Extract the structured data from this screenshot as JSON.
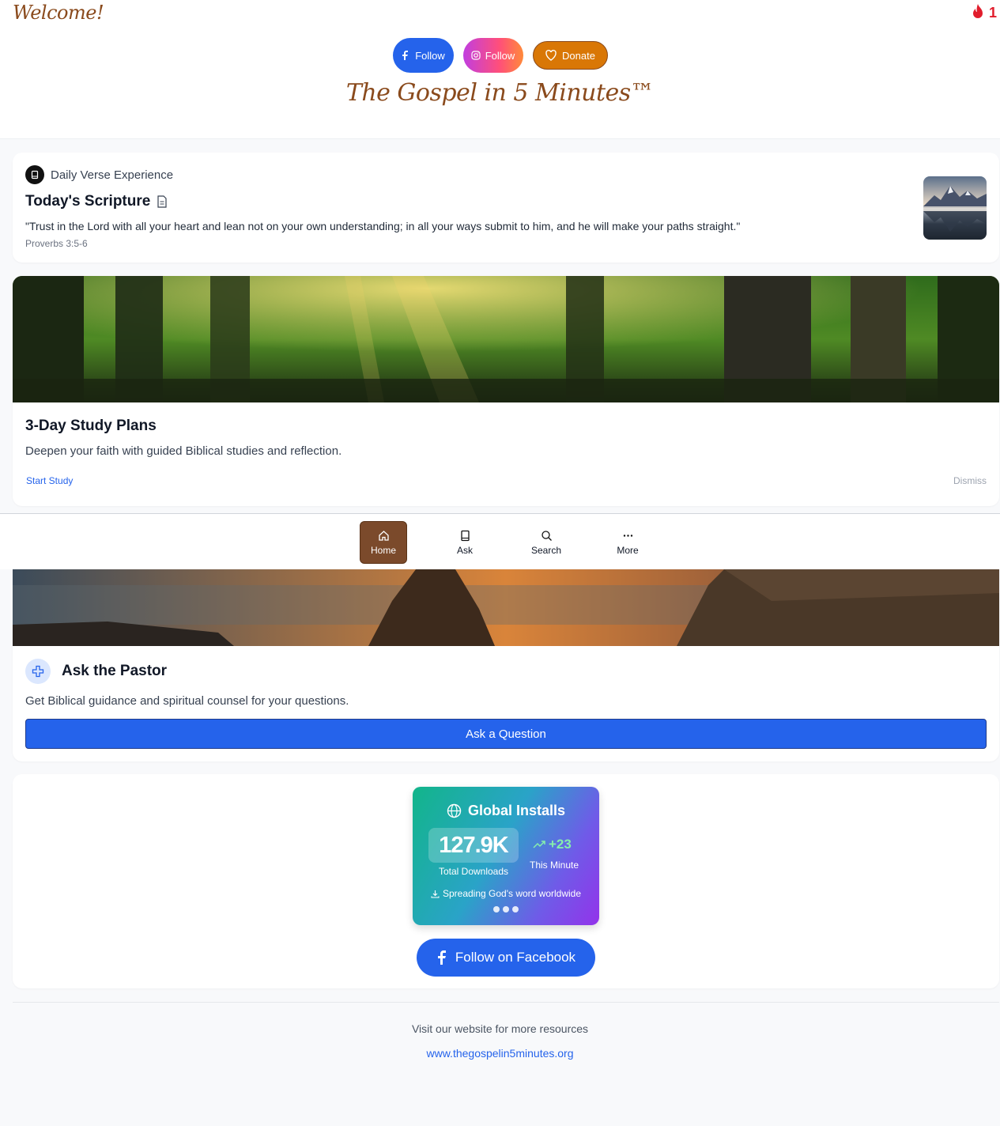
{
  "header": {
    "welcome": "Welcome!",
    "streak_count": "1",
    "facebook_follow": "Follow",
    "instagram_follow": "Follow",
    "donate": "Donate",
    "brand": "The Gospel in 5 Minutes™"
  },
  "daily_verse": {
    "label": "Daily Verse Experience",
    "title": "Today's Scripture",
    "text": "\"Trust in the Lord with all your heart and lean not on your own understanding; in all your ways submit to him, and he will make your paths straight.\"",
    "reference": "Proverbs 3:5-6"
  },
  "study_plan": {
    "title": "3-Day Study Plans",
    "description": "Deepen your faith with guided Biblical studies and reflection.",
    "start": "Start Study",
    "dismiss": "Dismiss"
  },
  "nav": {
    "items": [
      {
        "label": "Home",
        "icon": "home-icon",
        "active": true
      },
      {
        "label": "Ask",
        "icon": "book-icon"
      },
      {
        "label": "Search",
        "icon": "search-icon"
      },
      {
        "label": "More",
        "icon": "more-icon"
      }
    ]
  },
  "ask_pastor": {
    "title": "Ask the Pastor",
    "description": "Get Biblical guidance and spiritual counsel for your questions.",
    "button": "Ask a Question"
  },
  "installs": {
    "title": "Global Installs",
    "total": "127.9K",
    "total_label": "Total Downloads",
    "delta": "+23",
    "delta_label": "This Minute",
    "tagline": "Spreading God's word worldwide",
    "facebook_button": "Follow on Facebook"
  },
  "footer": {
    "text": "Visit our website for more resources",
    "link": "www.thegospelin5minutes.org"
  },
  "colors": {
    "brand_brown": "#8a4a1c",
    "primary_blue": "#2563eb",
    "donate_orange": "#d97706",
    "nav_active": "#7b4a2b"
  }
}
